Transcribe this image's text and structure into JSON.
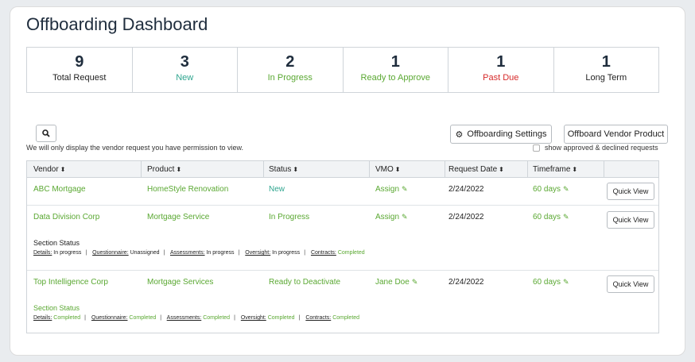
{
  "title": "Offboarding Dashboard",
  "stats": [
    {
      "num": "9",
      "label": "Total Request",
      "color": "#222222"
    },
    {
      "num": "3",
      "label": "New",
      "color": "#2fa58f"
    },
    {
      "num": "2",
      "label": "In Progress",
      "color": "#5aa832"
    },
    {
      "num": "1",
      "label": "Ready to Approve",
      "color": "#5aa832"
    },
    {
      "num": "1",
      "label": "Past Due",
      "color": "#d62a2a"
    },
    {
      "num": "1",
      "label": "Long Term",
      "color": "#222222"
    }
  ],
  "toolbar": {
    "search_icon": "search-icon",
    "settings_label": "Offboarding Settings",
    "offboard_label": "Offboard Vendor Product",
    "settings_icon": "gear-icon"
  },
  "note": "We will only display the vendor request you have permission to view.",
  "checkbox_label": "show approved & declined requests",
  "columns": [
    "Vendor",
    "Product",
    "Status",
    "VMO",
    "Request Date",
    "Timeframe"
  ],
  "rows": [
    {
      "vendor": "ABC Mortgage",
      "product": "HomeStyle Renovation",
      "status": "New",
      "vmo": "Assign",
      "date": "2/24/2022",
      "timeframe": "60 days",
      "action": "Quick View"
    },
    {
      "vendor": "Data Division Corp",
      "product": "Mortgage Service",
      "status": "In Progress",
      "vmo": "Assign",
      "date": "2/24/2022",
      "timeframe": "60 days",
      "action": "Quick View",
      "section": {
        "title": "Section Status",
        "items": [
          {
            "label": "Details:",
            "value": "In progress"
          },
          {
            "label": "Questionnaire:",
            "value": "Unassigned"
          },
          {
            "label": "Assessments:",
            "value": "In progress"
          },
          {
            "label": "Oversight:",
            "value": "In progress"
          },
          {
            "label": "Contracts:",
            "value": "Completed"
          }
        ]
      }
    },
    {
      "vendor": "Top Intelligence Corp",
      "product": "Mortgage Services",
      "status": "Ready to Deactivate",
      "vmo": "Jane Doe",
      "date": "2/24/2022",
      "timeframe": "60 days",
      "action": "Quick View",
      "section": {
        "title": "Section Status",
        "items": [
          {
            "label": "Details:",
            "value": "Completed"
          },
          {
            "label": "Questionnaire:",
            "value": "Completed"
          },
          {
            "label": "Assessments:",
            "value": "Completed"
          },
          {
            "label": "Oversight:",
            "value": "Completed"
          },
          {
            "label": "Contracts:",
            "value": "Completed"
          }
        ]
      }
    }
  ],
  "colors": {
    "green": "#5aa832",
    "teal": "#2fa58f",
    "red": "#d62a2a"
  }
}
